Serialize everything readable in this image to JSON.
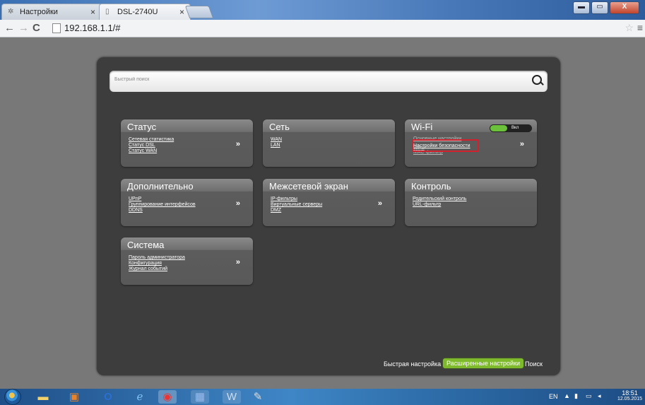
{
  "browser": {
    "tabs": [
      {
        "label": "Настройки",
        "icon": "gear-icon"
      },
      {
        "label": "DSL-2740U",
        "icon": "page-icon"
      }
    ],
    "url": "192.168.1.1/#"
  },
  "search": {
    "placeholder": "Быстрый поиск"
  },
  "cards": {
    "status": {
      "title": "Статус",
      "links": [
        "Сетевая статистика",
        "Статус DSL",
        "Статус WAN"
      ],
      "arrow": "»"
    },
    "network": {
      "title": "Сеть",
      "links": [
        "WAN",
        "LAN"
      ]
    },
    "wifi": {
      "title": "Wi-Fi",
      "toggle": "Вкл",
      "links": [
        "Основные настройки",
        "Настройки безопасности",
        "WPS",
        "MAC-фильтр"
      ],
      "arrow": "»"
    },
    "advanced": {
      "title": "Дополнительно",
      "links": [
        "UPnP",
        "Группирование интерфейсов",
        "DDNS"
      ],
      "arrow": "»"
    },
    "firewall": {
      "title": "Межсетевой экран",
      "links": [
        "IP-фильтры",
        "Виртуальные серверы",
        "DMZ"
      ],
      "arrow": "»"
    },
    "control": {
      "title": "Контроль",
      "links": [
        "Родительский контроль",
        "URL-фильтр"
      ]
    },
    "system": {
      "title": "Система",
      "links": [
        "Пароль администратора",
        "Конфигурация",
        "Журнал событий"
      ],
      "arrow": "»"
    }
  },
  "bottom_nav": {
    "quick": "Быстрая настройка",
    "advanced": "Расширенные настройки",
    "search": "Поиск"
  },
  "taskbar": {
    "lang": "EN",
    "time": "18:51",
    "date": "12.05.2015"
  },
  "colors": {
    "panel": "#3d3d3d",
    "accent": "#7fba2d",
    "highlight": "#d3202e"
  }
}
